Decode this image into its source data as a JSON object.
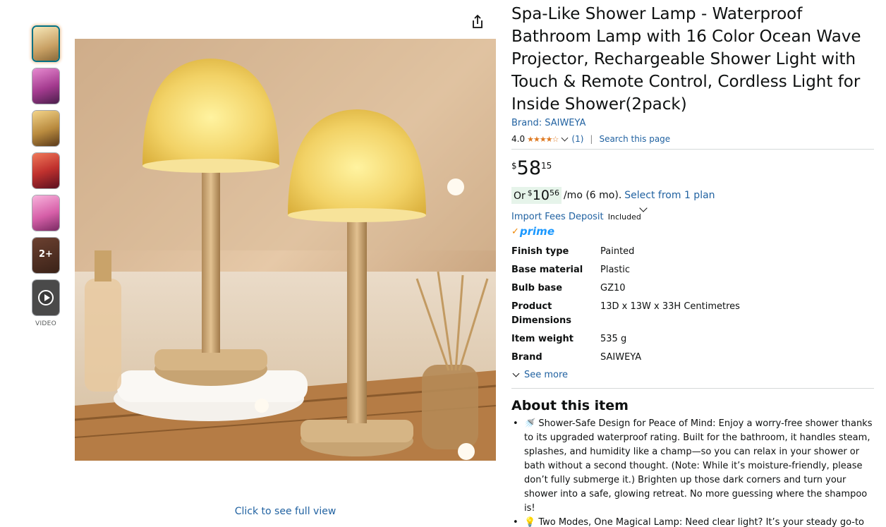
{
  "thumbnails": [
    {
      "label": "",
      "color": "#d4b27a"
    },
    {
      "label": "",
      "color": "#c24fa0"
    },
    {
      "label": "",
      "color": "#b98b3f"
    },
    {
      "label": "",
      "color": "#c0312e"
    },
    {
      "label": "",
      "color": "#d65fa8"
    },
    {
      "label": "2+",
      "color": "#4a2b1e"
    },
    {
      "label": "",
      "color": "#3d3d3d"
    }
  ],
  "video_label": "VIDEO",
  "full_view_link": "Click to see full view",
  "product": {
    "title": "Spa-Like Shower Lamp - Waterproof Bathroom Lamp with 16 Color Ocean Wave Projector, Rechargeable Shower Light with Touch & Remote Control, Cordless Light for Inside Shower(2pack)",
    "brand_link": "Brand: SAIWEYA",
    "rating_value": "4.0",
    "stars": "★★★★☆",
    "rating_count": "(1)",
    "search_link": "Search this page",
    "price": {
      "symbol": "$",
      "whole": "58",
      "fraction": "15"
    },
    "monthly": {
      "or": "Or",
      "symbol": "$",
      "whole": "10",
      "fraction": "56",
      "rest": "/mo (6 mo).",
      "plan_link": "Select from 1 plan"
    },
    "import_fees": "Import Fees Deposit",
    "import_included": "Included",
    "prime": "prime",
    "prime_check": "✓"
  },
  "specs": [
    {
      "key": "Finish type",
      "value": "Painted"
    },
    {
      "key": "Base material",
      "value": "Plastic"
    },
    {
      "key": "Bulb base",
      "value": "GZ10"
    },
    {
      "key": "Product Dimensions",
      "value": "13D x 13W x 33H Centimetres"
    },
    {
      "key": "Item weight",
      "value": "535 g"
    },
    {
      "key": "Brand",
      "value": "SAIWEYA"
    }
  ],
  "see_more": "See more",
  "about_title": "About this item",
  "bullets": [
    "🚿 Shower-Safe Design for Peace of Mind: Enjoy a worry-free shower thanks to its upgraded waterproof rating. Built for the bathroom, it handles steam, splashes, and humidity like a champ—so you can relax in your shower or bath without a second thought. (Note: While it’s moisture-friendly, please don’t fully submerge it.) Brighten up those dark corners and turn your shower into a safe, glowing retreat. No more guessing where the shampoo is!",
    "💡 Two Modes, One Magical Lamp: Need clear light? It’s your steady go-to"
  ]
}
